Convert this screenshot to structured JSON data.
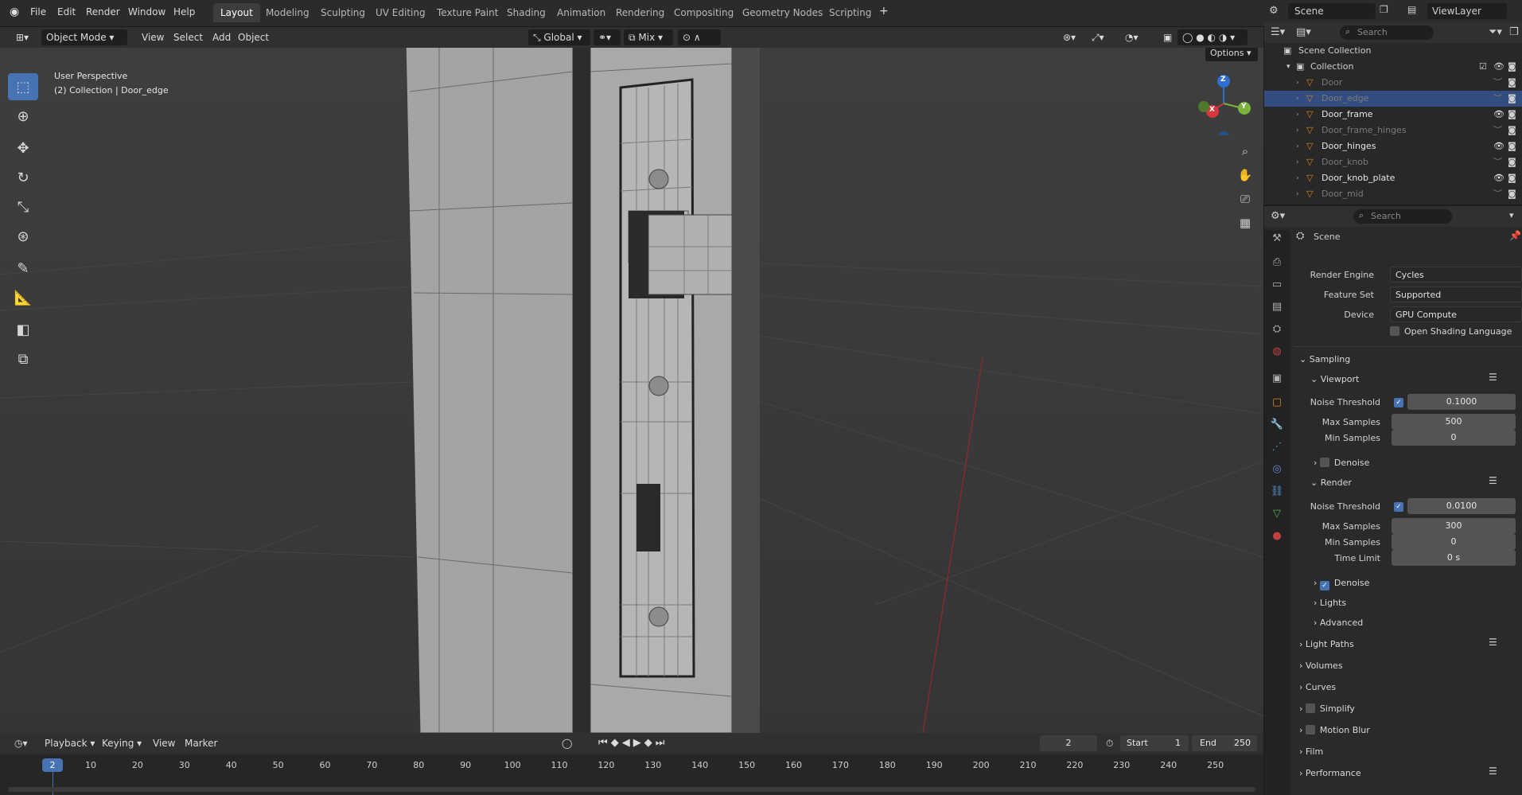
{
  "topbar": {
    "menus": [
      "File",
      "Edit",
      "Render",
      "Window",
      "Help"
    ],
    "tabs": [
      "Layout",
      "Modeling",
      "Sculpting",
      "UV Editing",
      "Texture Paint",
      "Shading",
      "Animation",
      "Rendering",
      "Compositing",
      "Geometry Nodes",
      "Scripting"
    ],
    "add_tab": "+",
    "scene": "Scene",
    "view_layer": "ViewLayer"
  },
  "viewport_header": {
    "mode": "Object Mode",
    "menus": [
      "View",
      "Select",
      "Add",
      "Object"
    ],
    "transform_orientation": "Global",
    "snap": "Mix",
    "options": "Options"
  },
  "viewport": {
    "view_name": "User Perspective",
    "collection_info": "(2) Collection | Door_edge",
    "gizmo": {
      "z": "Z",
      "x": "X",
      "y": "Y"
    }
  },
  "outliner": {
    "search_placeholder": "Search",
    "scene_collection": "Scene Collection",
    "collection": "Collection",
    "items": [
      {
        "name": "Door",
        "visible": false,
        "selected": false
      },
      {
        "name": "Door_edge",
        "visible": false,
        "selected": true
      },
      {
        "name": "Door_frame",
        "visible": true,
        "selected": false
      },
      {
        "name": "Door_frame_hinges",
        "visible": false,
        "selected": false
      },
      {
        "name": "Door_hinges",
        "visible": true,
        "selected": false
      },
      {
        "name": "Door_knob",
        "visible": false,
        "selected": false
      },
      {
        "name": "Door_knob_plate",
        "visible": true,
        "selected": false
      },
      {
        "name": "Door_mid",
        "visible": false,
        "selected": false
      }
    ]
  },
  "properties": {
    "search_placeholder": "Search",
    "context": "Scene",
    "render_engine_label": "Render Engine",
    "render_engine": "Cycles",
    "feature_set_label": "Feature Set",
    "feature_set": "Supported",
    "device_label": "Device",
    "device": "GPU Compute",
    "osl": "Open Shading Language",
    "sampling": "Sampling",
    "viewport": "Viewport",
    "noise_threshold_label": "Noise Threshold",
    "viewport_noise_threshold": "0.1000",
    "max_samples_label": "Max Samples",
    "viewport_max_samples": "500",
    "min_samples_label": "Min Samples",
    "viewport_min_samples": "0",
    "denoise": "Denoise",
    "render": "Render",
    "render_noise_threshold": "0.0100",
    "render_max_samples": "300",
    "render_min_samples": "0",
    "time_limit_label": "Time Limit",
    "time_limit": "0 s",
    "lights": "Lights",
    "advanced": "Advanced",
    "light_paths": "Light Paths",
    "volumes": "Volumes",
    "curves": "Curves",
    "simplify": "Simplify",
    "motion_blur": "Motion Blur",
    "film": "Film",
    "performance": "Performance"
  },
  "timeline": {
    "menus": [
      "Playback",
      "Keying",
      "View",
      "Marker"
    ],
    "current_frame": "2",
    "start_label": "Start",
    "start": "1",
    "end_label": "End",
    "end": "250",
    "ticks": [
      "10",
      "20",
      "30",
      "40",
      "50",
      "60",
      "70",
      "80",
      "90",
      "100",
      "110",
      "120",
      "130",
      "140",
      "150",
      "160",
      "170",
      "180",
      "190",
      "200",
      "210",
      "220",
      "230",
      "240",
      "250"
    ]
  }
}
